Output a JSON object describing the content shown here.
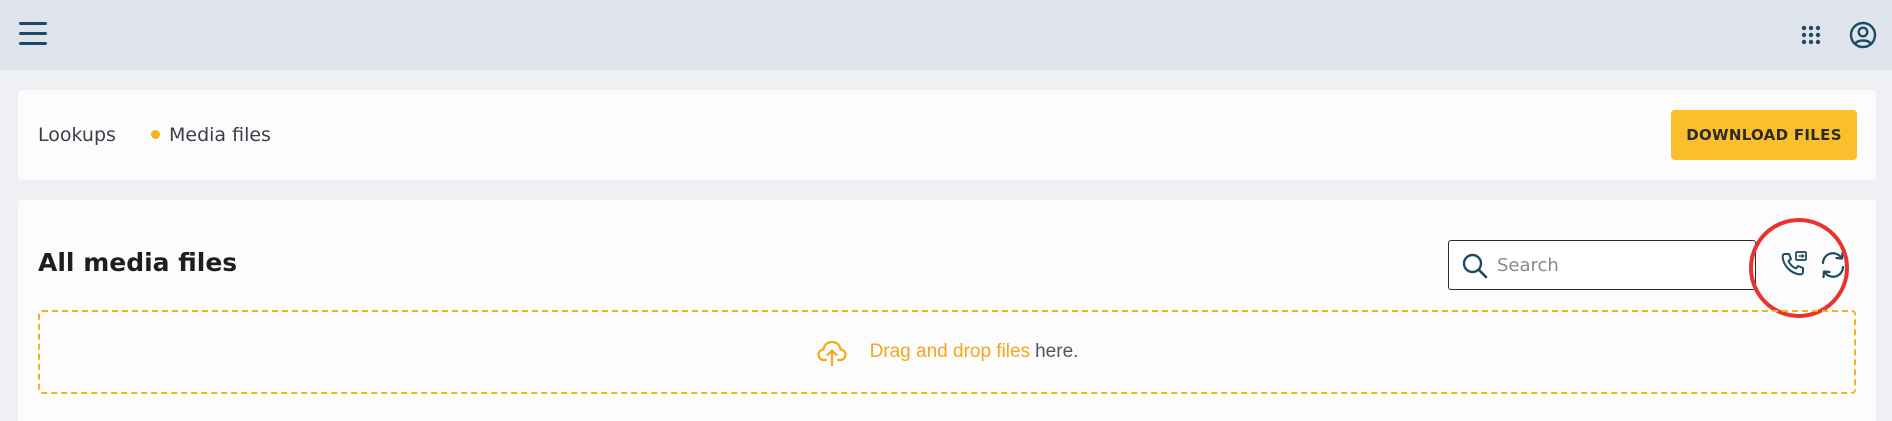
{
  "topbar": {
    "menu_icon": "hamburger-menu-icon",
    "apps_icon": "apps-grid-icon",
    "account_icon": "account-circle-icon"
  },
  "breadcrumb": {
    "items": [
      {
        "label": "Lookups"
      },
      {
        "label": "Media files"
      }
    ]
  },
  "actions": {
    "download_label": "DOWNLOAD FILES"
  },
  "media": {
    "title": "All media files",
    "search_placeholder": "Search",
    "search_value": "",
    "sync_icon": "call-sync-icon",
    "refresh_icon": "refresh-icon",
    "dropzone": {
      "link_text": "Drag and drop files",
      "rest_text": "here."
    }
  },
  "colors": {
    "accent": "#fbbf2d",
    "link": "#f2a81c",
    "highlight": "#e8342f",
    "topbar": "#dfe4ec",
    "icon": "#1f4a64"
  }
}
